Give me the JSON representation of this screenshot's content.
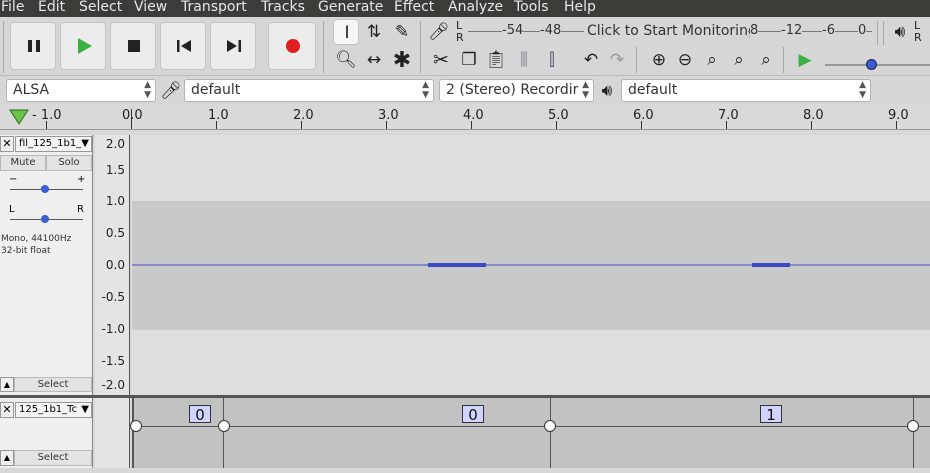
{
  "menu": [
    "File",
    "Edit",
    "Select",
    "View",
    "Transport",
    "Tracks",
    "Generate",
    "Effect",
    "Analyze",
    "Tools",
    "Help"
  ],
  "transport": [
    "pause-icon",
    "play-icon",
    "stop-icon",
    "skip-start-icon",
    "skip-end-icon",
    "record-icon"
  ],
  "meter": {
    "record_lr": "L\nR",
    "scale": [
      "-54",
      "-48"
    ],
    "monitor_text": "Click to Start Monitoring",
    "scale2": [
      "8",
      "-12",
      "-6",
      "0"
    ]
  },
  "device": {
    "host": "ALSA",
    "recording_device": "default",
    "channels": "2 (Stereo) Recordir",
    "playback_device": "default"
  },
  "ruler": {
    "labels": [
      "- 1.0",
      "0.0",
      "1.0",
      "2.0",
      "3.0",
      "4.0",
      "5.0",
      "6.0",
      "7.0",
      "8.0",
      "9.0"
    ]
  },
  "track1": {
    "name": "fil_125_1b1_",
    "mute": "Mute",
    "solo": "Solo",
    "gain_minus": "−",
    "gain_plus": "+",
    "pan_left": "L",
    "pan_right": "R",
    "info_line1": "Mono, 44100Hz",
    "info_line2": "32-bit float",
    "select": "Select",
    "vscale": [
      "2.0",
      "1.5",
      "1.0",
      "0.5",
      "0.0",
      "-0.5",
      "-1.0",
      "-1.5",
      "-2.0"
    ]
  },
  "track2": {
    "name": "125_1b1_Tc",
    "select": "Select",
    "labels": [
      "0",
      "0",
      "1"
    ]
  },
  "colors": {
    "menubar": "#3b3b37",
    "waveform": "#3b4bc8",
    "record": "#e02020",
    "play": "#3cb043"
  }
}
